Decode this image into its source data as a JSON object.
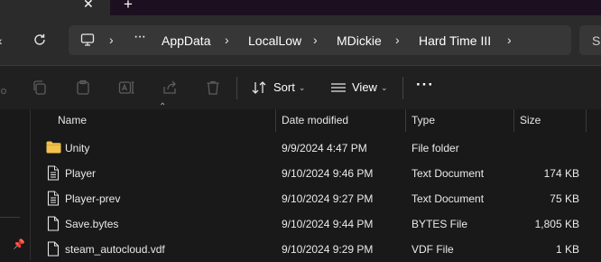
{
  "tabs": {
    "close_glyph": "✕",
    "new_glyph": "+"
  },
  "address": {
    "overflow_label": "···",
    "crumbs": [
      "AppData",
      "LocalLow",
      "MDickie",
      "Hard Time III"
    ],
    "separator": "›",
    "search_label": "Se"
  },
  "toolbar": {
    "sort_label": "Sort",
    "view_label": "View",
    "more_label": "···",
    "chevron": "⌄"
  },
  "columns": {
    "name": "Name",
    "date": "Date modified",
    "type": "Type",
    "size": "Size"
  },
  "files": [
    {
      "name": "Unity",
      "date": "9/9/2024 4:47 PM",
      "type": "File folder",
      "size": "",
      "icon": "folder-icon"
    },
    {
      "name": "Player",
      "date": "9/10/2024 9:46 PM",
      "type": "Text Document",
      "size": "174 KB",
      "icon": "document-icon"
    },
    {
      "name": "Player-prev",
      "date": "9/10/2024 9:27 PM",
      "type": "Text Document",
      "size": "75 KB",
      "icon": "document-icon"
    },
    {
      "name": "Save.bytes",
      "date": "9/10/2024 9:44 PM",
      "type": "BYTES File",
      "size": "1,805 KB",
      "icon": "file-icon"
    },
    {
      "name": "steam_autocloud.vdf",
      "date": "9/10/2024 9:29 PM",
      "type": "VDF File",
      "size": "1 KB",
      "icon": "file-icon"
    }
  ],
  "colors": {
    "folder": "#f2c14e",
    "accent": "#4cc2ff",
    "background": "#191919"
  }
}
